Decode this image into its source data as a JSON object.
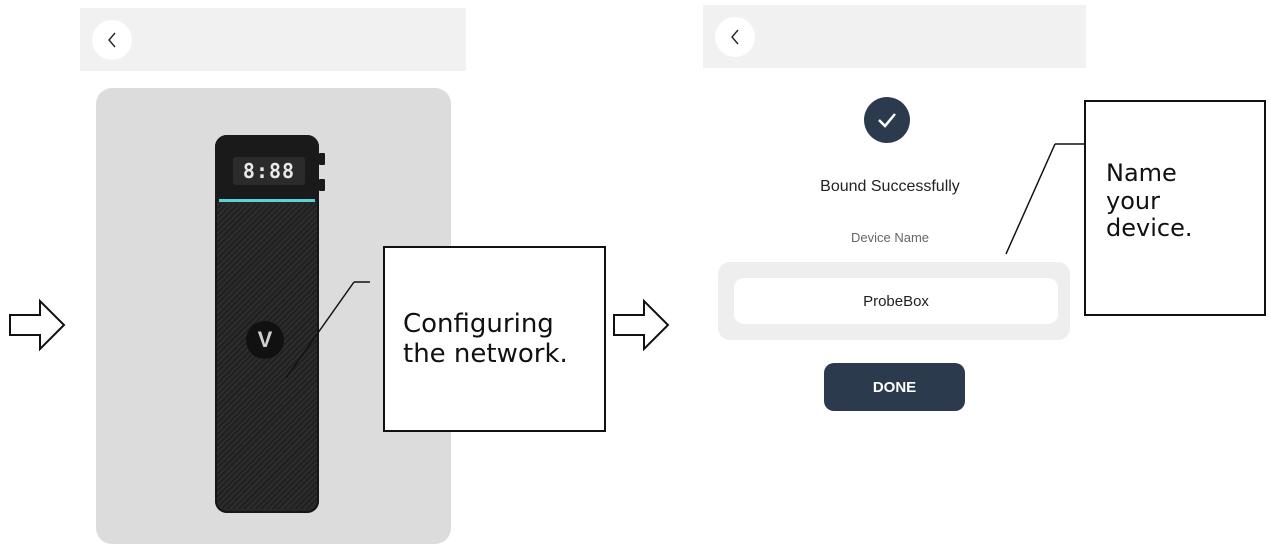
{
  "left_screen": {
    "device_display": "8:88"
  },
  "callouts": {
    "configuring": "Configuring the network.",
    "name_device": "Name your device."
  },
  "right_screen": {
    "status_title": "Bound Successfully",
    "field_label": "Device Name",
    "device_name_value": "ProbeBox",
    "done_label": "DONE"
  },
  "colors": {
    "accent_dark": "#2b3a4d",
    "lcd_bar": "#59d3d6"
  },
  "icons": {
    "back": "chevron-left-icon",
    "success": "check-circle-icon",
    "flow": "arrow-right-outline-icon"
  }
}
